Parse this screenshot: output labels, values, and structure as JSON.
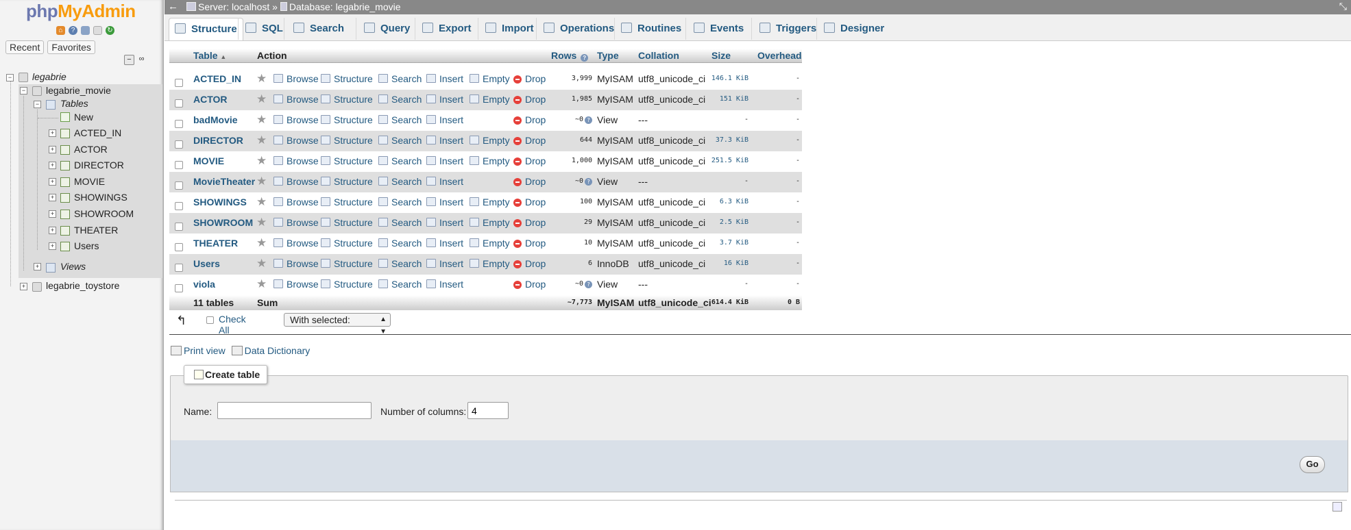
{
  "nav": {
    "logo_php": "php",
    "logo_myadmin": "MyAdmin",
    "recent_label": "Recent",
    "favorites_label": "Favorites",
    "tree": {
      "root": "legabrie",
      "db1": "legabrie_movie",
      "tables_group": "Tables",
      "new_item": "New",
      "tables": [
        "ACTED_IN",
        "ACTOR",
        "DIRECTOR",
        "MOVIE",
        "SHOWINGS",
        "SHOWROOM",
        "THEATER",
        "Users"
      ],
      "views_group": "Views",
      "db2": "legabrie_toystore"
    }
  },
  "topbar": {
    "breadcrumb_server": "Server: localhost",
    "breadcrumb_sep": "»",
    "breadcrumb_db": "Database: legabrie_movie"
  },
  "tabs": [
    {
      "label": "Structure",
      "icon": "structure-icon",
      "active": true
    },
    {
      "label": "SQL",
      "icon": "sql-icon"
    },
    {
      "label": "Search",
      "icon": "search-icon"
    },
    {
      "label": "Query",
      "icon": "query-icon"
    },
    {
      "label": "Export",
      "icon": "export-icon"
    },
    {
      "label": "Import",
      "icon": "import-icon"
    },
    {
      "label": "Operations",
      "icon": "wrench-icon"
    },
    {
      "label": "Routines",
      "icon": "routines-icon"
    },
    {
      "label": "Events",
      "icon": "clock-icon"
    },
    {
      "label": "Triggers",
      "icon": "triggers-icon"
    },
    {
      "label": "Designer",
      "icon": "designer-icon"
    }
  ],
  "table_header": {
    "table": "Table",
    "action": "Action",
    "rows": "Rows",
    "type": "Type",
    "collation": "Collation",
    "size": "Size",
    "overhead": "Overhead"
  },
  "actions": {
    "browse": "Browse",
    "structure": "Structure",
    "search": "Search",
    "insert": "Insert",
    "empty": "Empty",
    "drop": "Drop"
  },
  "rows": [
    {
      "name": "ACTED_IN",
      "rows": "3,999",
      "type": "MyISAM",
      "collation": "utf8_unicode_ci",
      "size": "146.1 KiB",
      "overhead": "-",
      "view": false
    },
    {
      "name": "ACTOR",
      "rows": "1,985",
      "type": "MyISAM",
      "collation": "utf8_unicode_ci",
      "size": "151 KiB",
      "overhead": "-",
      "view": false
    },
    {
      "name": "badMovie",
      "rows": "~0",
      "type": "View",
      "collation": "---",
      "size": "-",
      "overhead": "-",
      "view": true
    },
    {
      "name": "DIRECTOR",
      "rows": "644",
      "type": "MyISAM",
      "collation": "utf8_unicode_ci",
      "size": "37.3 KiB",
      "overhead": "-",
      "view": false
    },
    {
      "name": "MOVIE",
      "rows": "1,000",
      "type": "MyISAM",
      "collation": "utf8_unicode_ci",
      "size": "251.5 KiB",
      "overhead": "-",
      "view": false
    },
    {
      "name": "MovieTheater",
      "rows": "~0",
      "type": "View",
      "collation": "---",
      "size": "-",
      "overhead": "-",
      "view": true
    },
    {
      "name": "SHOWINGS",
      "rows": "100",
      "type": "MyISAM",
      "collation": "utf8_unicode_ci",
      "size": "6.3 KiB",
      "overhead": "-",
      "view": false
    },
    {
      "name": "SHOWROOM",
      "rows": "29",
      "type": "MyISAM",
      "collation": "utf8_unicode_ci",
      "size": "2.5 KiB",
      "overhead": "-",
      "view": false
    },
    {
      "name": "THEATER",
      "rows": "10",
      "type": "MyISAM",
      "collation": "utf8_unicode_ci",
      "size": "3.7 KiB",
      "overhead": "-",
      "view": false
    },
    {
      "name": "Users",
      "rows": "6",
      "type": "InnoDB",
      "collation": "utf8_unicode_ci",
      "size": "16 KiB",
      "overhead": "-",
      "view": false
    },
    {
      "name": "viola",
      "rows": "~0",
      "type": "View",
      "collation": "---",
      "size": "-",
      "overhead": "-",
      "view": true
    }
  ],
  "summary": {
    "count": "11 tables",
    "label": "Sum",
    "rows": "~7,773",
    "type": "MyISAM",
    "collation": "utf8_unicode_ci",
    "size": "614.4 KiB",
    "overhead": "0 B"
  },
  "bulk": {
    "check_all": "Check All",
    "with_selected": "With selected:"
  },
  "links": {
    "print_view": "Print view",
    "data_dictionary": "Data Dictionary"
  },
  "create_table": {
    "legend": "Create table",
    "name_label": "Name:",
    "name_value": "",
    "columns_label": "Number of columns:",
    "columns_value": "4",
    "go_label": "Go"
  }
}
